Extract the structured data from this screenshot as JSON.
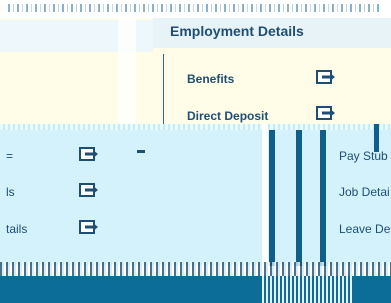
{
  "employment": {
    "title": "Employment Details",
    "links": {
      "benefits": "Benefits",
      "direct_deposit": "Direct Deposit"
    }
  },
  "left_column": {
    "items": [
      {
        "label": "="
      },
      {
        "label": "ls"
      },
      {
        "label": "tails"
      }
    ]
  },
  "right_column": {
    "items": [
      {
        "label": "Pay Stub"
      },
      {
        "label": "Job Detai"
      },
      {
        "label": "Leave De"
      }
    ]
  },
  "icons": {
    "link_icon": "arrow-into-box-icon"
  },
  "colors": {
    "accent": "#1f4e74",
    "band": "#d3f2fb",
    "panel": "#fffde7",
    "footer": "#0c6e98"
  }
}
